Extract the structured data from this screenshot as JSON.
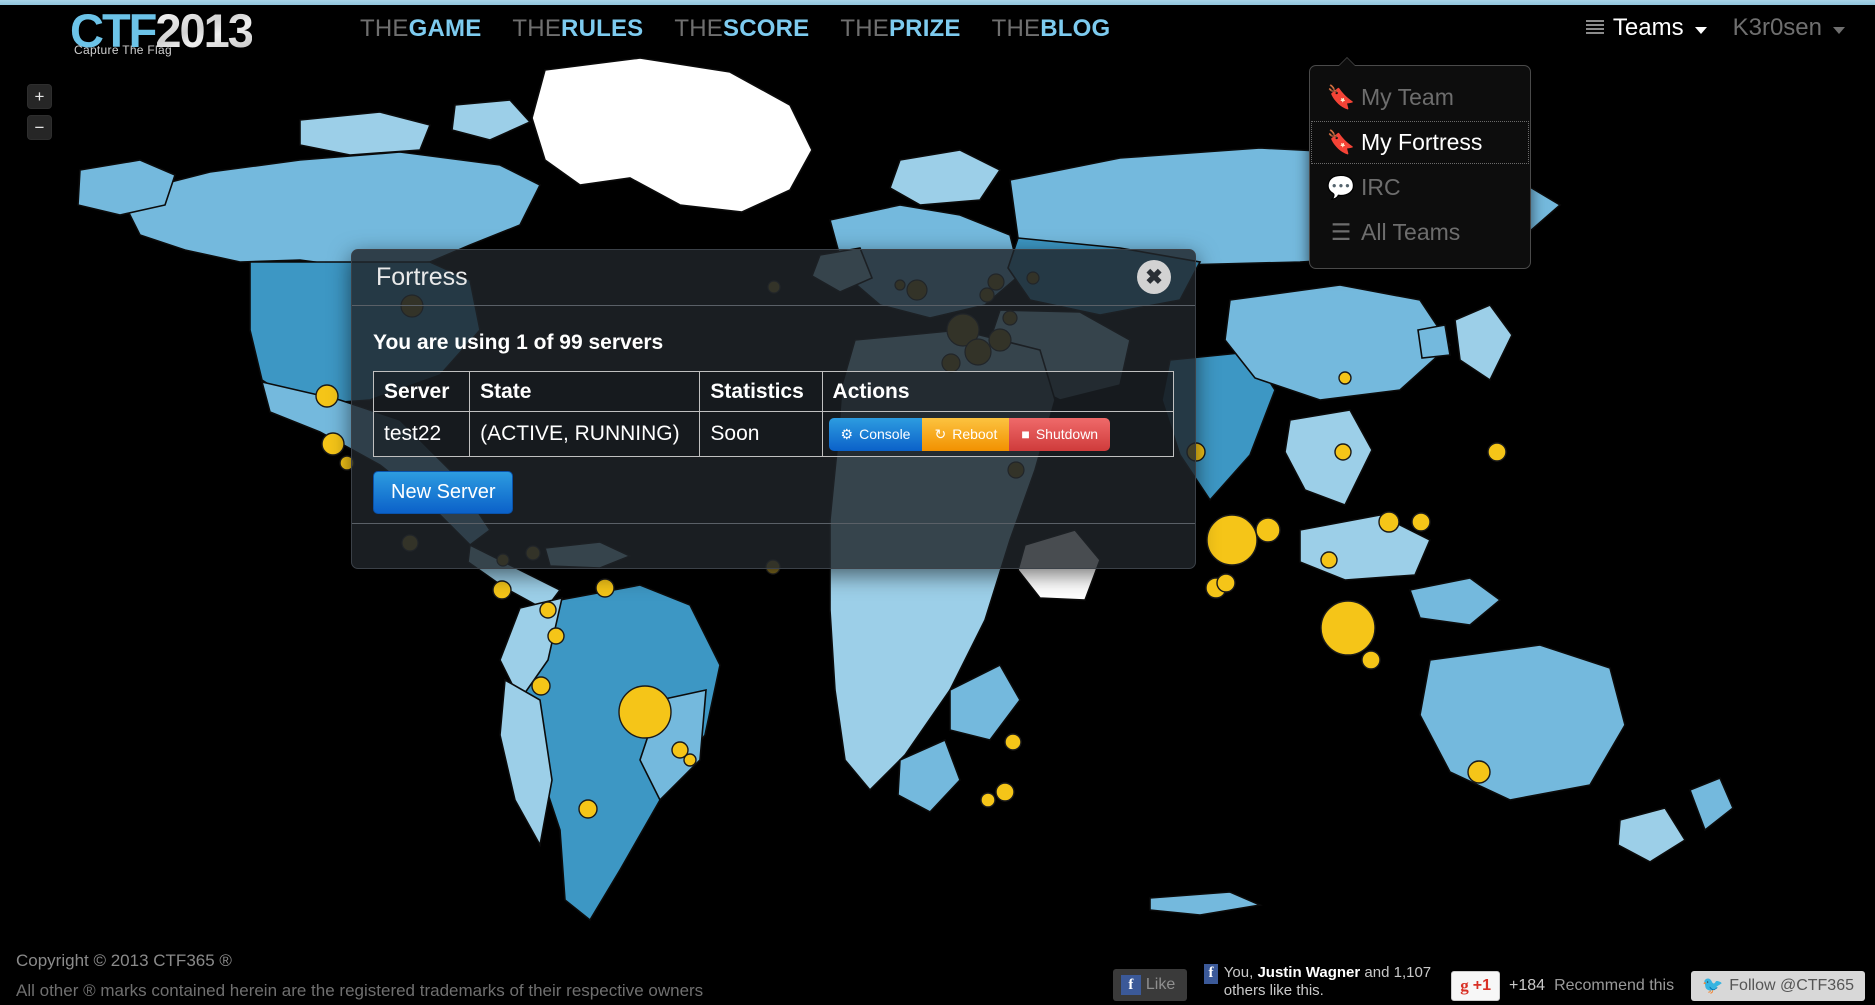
{
  "site": {
    "logo_main": "CTF",
    "logo_year": "2013",
    "logo_tagline": "Capture The Flag"
  },
  "nav": {
    "items": [
      {
        "prefix": "THE",
        "label": "GAME"
      },
      {
        "prefix": "THE",
        "label": "RULES"
      },
      {
        "prefix": "THE",
        "label": "SCORE"
      },
      {
        "prefix": "THE",
        "label": "PRIZE"
      },
      {
        "prefix": "THE",
        "label": "BLOG"
      }
    ],
    "teams_label": "Teams",
    "teams_icon": "bars-icon",
    "user_label": "K3r0sen"
  },
  "dropdown": {
    "items": [
      {
        "label": "My Team",
        "icon": "bookmark-icon",
        "selected": false
      },
      {
        "label": "My Fortress",
        "icon": "bookmark-icon",
        "selected": true
      },
      {
        "label": "IRC",
        "icon": "comment-icon",
        "selected": false
      },
      {
        "label": "All Teams",
        "icon": "list-icon",
        "selected": false
      }
    ]
  },
  "map": {
    "zoom_in": "+",
    "zoom_out": "−",
    "colors": {
      "background": "#000000",
      "country_light": "#9ccfe8",
      "country_mid": "#74b9dd",
      "country_dark": "#3d97c4",
      "marker": "#f5c518",
      "border": "#0b0b0b"
    }
  },
  "modal": {
    "title": "Fortress",
    "close_icon": "close-icon",
    "close_label": "✖",
    "lead": "You are using 1 of 99 servers",
    "table": {
      "headers": [
        "Server",
        "State",
        "Statistics",
        "Actions"
      ],
      "rows": [
        {
          "server": "test22",
          "state": "(ACTIVE, RUNNING)",
          "statistics": "Soon",
          "actions": [
            {
              "label": "Console",
              "icon": "gear-icon",
              "color": "#1273d4"
            },
            {
              "label": "Reboot",
              "icon": "refresh-icon",
              "color": "#f5a623"
            },
            {
              "label": "Shutdown",
              "icon": "stop-icon",
              "color": "#de4d4d"
            }
          ]
        }
      ]
    },
    "new_server_label": "New Server"
  },
  "footer": {
    "copyright": "Copyright © 2013 CTF365 ®",
    "trademark": "All other ® marks contained herein are the registered trademarks of their respective owners",
    "facebook": {
      "like_label": "Like",
      "icon": "facebook-icon",
      "social_text_prefix": "You,",
      "social_text_name": "Justin Wagner",
      "social_text_suffix": "and 1,107 others like this."
    },
    "google": {
      "button_label": "+1",
      "icon": "google-plus-icon",
      "count": "+184",
      "recommend_label": "Recommend this"
    },
    "twitter": {
      "icon": "twitter-icon",
      "label": "Follow @CTF365"
    }
  }
}
